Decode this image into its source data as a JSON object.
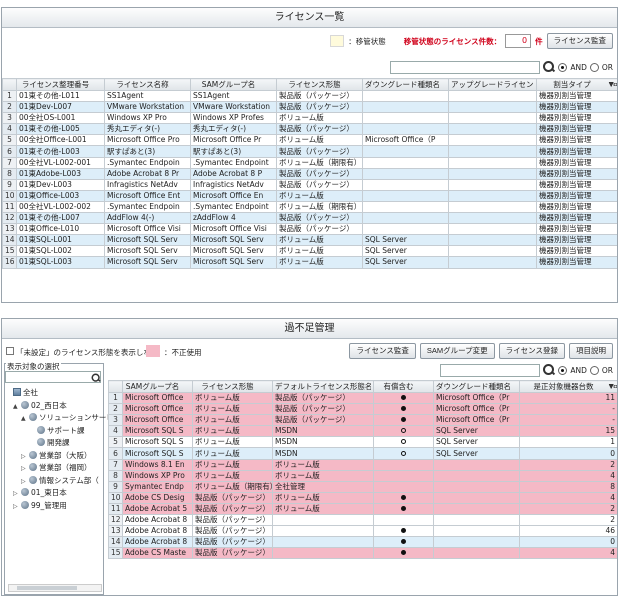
{
  "panel1": {
    "title": "ライセンス一覧",
    "legend_label": "：移管状態",
    "transfer_count_label": "移管状態のライセンス件数：",
    "transfer_count_value": "0",
    "transfer_count_unit": "件",
    "audit_button": "ライセンス監査",
    "search": {
      "and_label": "AND",
      "or_label": "OR",
      "mode": "AND"
    },
    "columns": [
      "",
      "ライセンス整理番号",
      "ライセンス名称",
      "SAMグループ名",
      "ライセンス形態",
      "ダウングレード種類名",
      "アップグレードライセンス",
      "割当タイプ"
    ],
    "rows": [
      [
        "1",
        "01東その他-L011",
        "SS1Agent",
        "SS1Agent",
        "製品版（パッケージ）",
        "",
        "",
        "機器別割当管理"
      ],
      [
        "2",
        "01東Dev-L007",
        "VMware Workstation",
        "VMware Workstation",
        "製品版（パッケージ）",
        "",
        "",
        "機器別割当管理"
      ],
      [
        "3",
        "00全社OS-L001",
        "Windows XP Pro",
        "Windows XP Profes",
        "ボリューム版",
        "",
        "",
        "機器別割当管理"
      ],
      [
        "4",
        "01東その他-L005",
        "秀丸エディタ(-)",
        "秀丸エディタ(-)",
        "製品版（パッケージ）",
        "",
        "",
        "機器別割当管理"
      ],
      [
        "5",
        "00全社Office-L001",
        "Microsoft Office Pro",
        "Microsoft Office Pr",
        "ボリューム版",
        "Microsoft Office（P",
        "",
        "機器別割当管理"
      ],
      [
        "6",
        "01東その他-L003",
        "駅すぱあと(3)",
        "駅すぱあと(3)",
        "製品版（パッケージ）",
        "",
        "",
        "機器別割当管理"
      ],
      [
        "7",
        "00全社VL-L002-001",
        ".Symantec Endpoin",
        ".Symantec Endpoint",
        "ボリューム版（期限有）",
        "",
        "",
        "機器別割当管理"
      ],
      [
        "8",
        "01東Adobe-L003",
        "Adobe Acrobat 8 Pr",
        "Adobe Acrobat 8 P",
        "製品版（パッケージ）",
        "",
        "",
        "機器別割当管理"
      ],
      [
        "9",
        "01東Dev-L003",
        "Infragistics NetAdv",
        "Infragistics NetAdv",
        "製品版（パッケージ）",
        "",
        "",
        "機器別割当管理"
      ],
      [
        "10",
        "01東Office-L003",
        "Microsoft Office Ent",
        "Microsoft Office En",
        "ボリューム版",
        "",
        "",
        "機器別割当管理"
      ],
      [
        "11",
        "00全社VL-L002-002",
        ".Symantec Endpoin",
        ".Symantec Endpoint",
        "ボリューム版（期限有）",
        "",
        "",
        "機器別割当管理"
      ],
      [
        "12",
        "01東その他-L007",
        "AddFlow 4(-)",
        "zAddFlow 4",
        "製品版（パッケージ）",
        "",
        "",
        "機器別割当管理"
      ],
      [
        "13",
        "01東Office-L010",
        "Microsoft Office Visi",
        "Microsoft Office Visi",
        "製品版（パッケージ）",
        "",
        "",
        "機器別割当管理"
      ],
      [
        "14",
        "01東SQL-L001",
        "Microsoft SQL Serv",
        "Microsoft SQL Serv",
        "ボリューム版",
        "SQL Server",
        "",
        "機器別割当管理"
      ],
      [
        "15",
        "01東SQL-L002",
        "Microsoft SQL Serv",
        "Microsoft SQL Serv",
        "ボリューム版",
        "SQL Server",
        "",
        "機器別割当管理"
      ],
      [
        "16",
        "01東SQL-L003",
        "Microsoft SQL Serv",
        "Microsoft SQL Serv",
        "ボリューム版",
        "SQL Server",
        "",
        "機器別割当管理"
      ]
    ]
  },
  "panel2": {
    "title": "過不足管理",
    "hide_unset_label": "「未設定」のライセンス形態を表示しない",
    "illegal_label": "：不正使用",
    "buttons": {
      "audit": "ライセンス監査",
      "sam_change": "SAMグループ変更",
      "register": "ライセンス登録",
      "item_desc": "項目説明"
    },
    "search": {
      "and_label": "AND",
      "or_label": "OR",
      "mode": "AND"
    },
    "tree_title": "表示対象の選択",
    "tree": [
      {
        "label": "全社",
        "depth": 0,
        "icon": "building-icon",
        "toggle": ""
      },
      {
        "label": "02_西日本",
        "depth": 1,
        "icon": "group-icon",
        "toggle": "▲"
      },
      {
        "label": "ソリューションサービ",
        "depth": 2,
        "icon": "group-icon",
        "toggle": "▲"
      },
      {
        "label": "サポート課",
        "depth": 3,
        "icon": "group-icon",
        "toggle": ""
      },
      {
        "label": "開発課",
        "depth": 3,
        "icon": "group-icon",
        "toggle": ""
      },
      {
        "label": "営業部（大阪）",
        "depth": 2,
        "icon": "group-icon",
        "toggle": "▷"
      },
      {
        "label": "営業部（福岡）",
        "depth": 2,
        "icon": "group-icon",
        "toggle": "▷"
      },
      {
        "label": "情報システム部（",
        "depth": 2,
        "icon": "group-icon",
        "toggle": "▷"
      },
      {
        "label": "01_東日本",
        "depth": 1,
        "icon": "group-icon",
        "toggle": "▷"
      },
      {
        "label": "99_管理用",
        "depth": 1,
        "icon": "group-icon",
        "toggle": "▷"
      }
    ],
    "columns": [
      "",
      "SAMグループ名",
      "ライセンス形態",
      "デフォルトライセンス形態名",
      "有償含む",
      "ダウングレード種類名",
      "是正対象機器台数"
    ],
    "rows": [
      {
        "cells": [
          "1",
          "Microsoft Office",
          "ボリューム版",
          "製品版（パッケージ）",
          "dot",
          "Microsoft Office（Pr",
          "11"
        ],
        "style": "pink"
      },
      {
        "cells": [
          "2",
          "Microsoft Office",
          "ボリューム版",
          "製品版（パッケージ）",
          "dot",
          "Microsoft Office（Pr",
          "-"
        ],
        "style": "pink"
      },
      {
        "cells": [
          "3",
          "Microsoft Office",
          "ボリューム版",
          "製品版（パッケージ）",
          "dot",
          "Microsoft Office（Pr",
          "-"
        ],
        "style": "pink"
      },
      {
        "cells": [
          "4",
          "Microsoft SQL S",
          "ボリューム版",
          "MSDN",
          "ring",
          "SQL Server",
          "15"
        ],
        "style": "pink"
      },
      {
        "cells": [
          "5",
          "Microsoft SQL S",
          "ボリューム版",
          "MSDN",
          "ring",
          "SQL Server",
          "1"
        ],
        "style": ""
      },
      {
        "cells": [
          "6",
          "Microsoft SQL S",
          "ボリューム版",
          "MSDN",
          "ring",
          "SQL Server",
          "0"
        ],
        "style": "alt"
      },
      {
        "cells": [
          "7",
          "Windows 8.1 En",
          "ボリューム版",
          "ボリューム版",
          "",
          "",
          "2"
        ],
        "style": "pink"
      },
      {
        "cells": [
          "8",
          "Windows XP Pro",
          "ボリューム版",
          "ボリューム版",
          "",
          "",
          "4"
        ],
        "style": "pink"
      },
      {
        "cells": [
          "9",
          "Symantec Endp",
          "ボリューム版（期限有）",
          "全社管理",
          "",
          "",
          "8"
        ],
        "style": "pink"
      },
      {
        "cells": [
          "10",
          "Adobe CS Desig",
          "製品版（パッケージ）",
          "ボリューム版",
          "dot",
          "",
          "4"
        ],
        "style": "pink"
      },
      {
        "cells": [
          "11",
          "Adobe Acrobat 5",
          "製品版（パッケージ）",
          "ボリューム版",
          "dot",
          "",
          "2"
        ],
        "style": "pink"
      },
      {
        "cells": [
          "12",
          "Adobe Acrobat 8",
          "製品版（パッケージ）",
          "",
          "",
          "",
          "2"
        ],
        "style": ""
      },
      {
        "cells": [
          "13",
          "Adobe Acrobat 8",
          "製品版（パッケージ）",
          "",
          "dot",
          "",
          "46"
        ],
        "style": ""
      },
      {
        "cells": [
          "14",
          "Adobe Acrobat 8",
          "製品版（パッケージ）",
          "",
          "dot",
          "",
          "0"
        ],
        "style": "alt"
      },
      {
        "cells": [
          "15",
          "Adobe CS Maste",
          "製品版（パッケージ）",
          "",
          "dot",
          "",
          "4"
        ],
        "style": "pink"
      }
    ]
  },
  "colors": {
    "legend_yellow": "#fffbdc",
    "illegal_pink": "#f5b9c6",
    "row_alt_blue": "#ddeef9",
    "warning_red": "#d0021b"
  }
}
